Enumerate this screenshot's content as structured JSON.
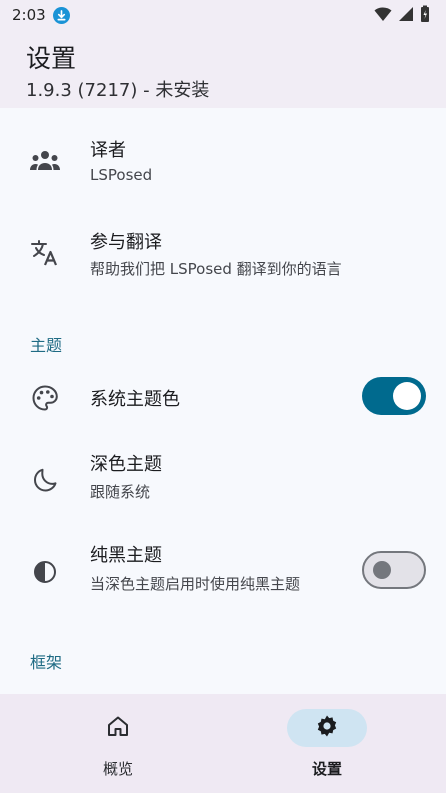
{
  "status_bar": {
    "time": "2:03"
  },
  "header": {
    "title": "设置",
    "subtitle": "1.9.3 (7217) - 未安装"
  },
  "items": {
    "translators": {
      "title": "译者",
      "subtitle": "LSPosed",
      "icon": "group-icon"
    },
    "translate": {
      "title": "参与翻译",
      "subtitle": "帮助我们把 LSPosed 翻译到你的语言",
      "icon": "translate-icon"
    },
    "system_color": {
      "title": "系统主题色",
      "icon": "palette-icon",
      "checked": true
    },
    "dark_theme": {
      "title": "深色主题",
      "subtitle": "跟随系统",
      "icon": "moon-icon"
    },
    "black_theme": {
      "title": "纯黑主题",
      "subtitle": "当深色主题启用时使用纯黑主题",
      "icon": "contrast-icon",
      "checked": false
    }
  },
  "sections": {
    "theme": "主题",
    "framework": "框架"
  },
  "nav": {
    "overview": "概览",
    "settings": "设置"
  },
  "colors": {
    "accent": "#006a8e",
    "section": "#1f6b84",
    "nav_active": "#cfe4f2"
  }
}
